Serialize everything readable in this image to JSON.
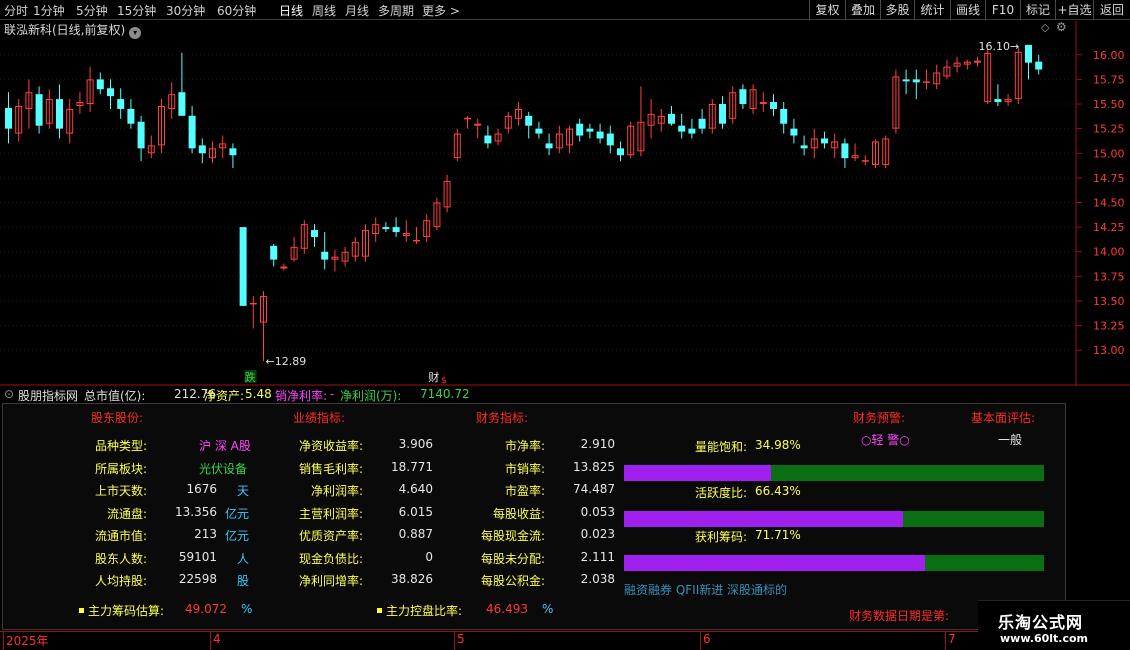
{
  "toolbar": {
    "periods": [
      "分时",
      "1分钟",
      "5分钟",
      "15分钟",
      "30分钟",
      "60分钟",
      "日线",
      "周线",
      "月线",
      "多周期",
      "更多 >"
    ],
    "active_period": "日线",
    "buttons": [
      "复权",
      "叠加",
      "多股",
      "统计",
      "画线",
      "F10",
      "标记",
      "+自选",
      "返回"
    ]
  },
  "chart": {
    "stock_title": "联泓新科(日线,前复权)",
    "settings_icon": "chevron-down-icon",
    "high_label": "16.10",
    "low_label": "12.89",
    "marker_down": "跌",
    "marker_fin": "财",
    "marker_fin_sub": "$"
  },
  "indicator": {
    "name": "股朋指标网",
    "total_mv_label": "总市值(亿):",
    "total_mv": "212.76",
    "net_assets_label": "净资产:",
    "net_assets": "5.48",
    "net_margin_label": "销净利率:",
    "net_margin": "-",
    "net_profit_label": "净利润(万):",
    "net_profit": "7140.72"
  },
  "panel": {
    "headers": {
      "holders": "股东股份:",
      "performance": "业绩指标:",
      "finance": "财务指标:",
      "warning": "财务预警:",
      "fundamental": "基本面评估:"
    },
    "col1": [
      {
        "label": "品种类型:",
        "value": "沪 深 A股",
        "unit": ""
      },
      {
        "label": "所属板块:",
        "value": "光伏设备",
        "unit": ""
      },
      {
        "label": "上市天数:",
        "value": "1676",
        "unit": "天"
      },
      {
        "label": "流通盘:",
        "value": "13.356",
        "unit": "亿元"
      },
      {
        "label": "流通市值:",
        "value": "213",
        "unit": "亿元"
      },
      {
        "label": "股东人数:",
        "value": "59101",
        "unit": "人"
      },
      {
        "label": "人均持股:",
        "value": "22598",
        "unit": "股"
      }
    ],
    "col2": [
      {
        "label": "净资收益率:",
        "value": "3.906"
      },
      {
        "label": "销售毛利率:",
        "value": "18.771"
      },
      {
        "label": "净利润率:",
        "value": "4.640"
      },
      {
        "label": "主营利润率:",
        "value": "6.015"
      },
      {
        "label": "优质资产率:",
        "value": "0.887"
      },
      {
        "label": "现金负债比:",
        "value": "0"
      },
      {
        "label": "净利同增率:",
        "value": "38.826"
      }
    ],
    "col3": [
      {
        "label": "市净率:",
        "value": "2.910"
      },
      {
        "label": "市销率:",
        "value": "13.825"
      },
      {
        "label": "市盈率:",
        "value": "74.487"
      },
      {
        "label": "每股收益:",
        "value": "0.053"
      },
      {
        "label": "每股现金流:",
        "value": "0.023"
      },
      {
        "label": "每股未分配:",
        "value": "2.111"
      },
      {
        "label": "每股公积金:",
        "value": "2.038"
      }
    ],
    "warning_value": "○轻 警○",
    "fundamental_value": "一般",
    "gauges": [
      {
        "label": "量能饱和:",
        "value": "34.98%",
        "fraction": 0.3498
      },
      {
        "label": "活跃度比:",
        "value": "66.43%",
        "fraction": 0.6643
      },
      {
        "label": "获利筹码:",
        "value": "71.71%",
        "fraction": 0.7171
      }
    ],
    "tags": "融资融券 QFII新进 深股通标的",
    "main_chip_label": "主力筹码估算:",
    "main_chip_value": "49.072",
    "main_chip_unit": "%",
    "main_control_label": "主力控盘比率:",
    "main_control_value": "46.493",
    "main_control_unit": "%",
    "fin_date_label": "财务数据日期是第:"
  },
  "date_axis": {
    "labels": [
      "2025年",
      "4",
      "5",
      "6",
      "7"
    ]
  },
  "watermark": {
    "line1": "乐淘公式网",
    "line2": "www.60lt.com"
  },
  "colors": {
    "up": "#ff4040",
    "down": "#54ffff",
    "axis": "#a01010"
  },
  "chart_data": {
    "type": "candlestick",
    "y_ticks": [
      "16.00",
      "15.75",
      "15.50",
      "15.25",
      "15.00",
      "14.75",
      "14.50",
      "14.25",
      "14.00",
      "13.75",
      "13.50",
      "13.25",
      "13.00"
    ],
    "ylim": [
      12.85,
      16.15
    ],
    "candles": [
      [
        15.46,
        15.62,
        15.1,
        15.25
      ],
      [
        15.2,
        15.55,
        15.12,
        15.48
      ],
      [
        15.45,
        15.75,
        15.25,
        15.62
      ],
      [
        15.6,
        15.68,
        15.2,
        15.28
      ],
      [
        15.3,
        15.65,
        15.25,
        15.55
      ],
      [
        15.55,
        15.7,
        15.15,
        15.25
      ],
      [
        15.2,
        15.55,
        15.1,
        15.45
      ],
      [
        15.48,
        15.62,
        15.4,
        15.52
      ],
      [
        15.5,
        15.88,
        15.42,
        15.75
      ],
      [
        15.75,
        15.82,
        15.6,
        15.65
      ],
      [
        15.66,
        15.75,
        15.45,
        15.58
      ],
      [
        15.55,
        15.66,
        15.35,
        15.45
      ],
      [
        15.45,
        15.55,
        15.25,
        15.3
      ],
      [
        15.32,
        15.38,
        14.92,
        15.05
      ],
      [
        15.0,
        15.18,
        14.95,
        15.08
      ],
      [
        15.08,
        15.55,
        15.0,
        15.48
      ],
      [
        15.45,
        15.72,
        15.35,
        15.6
      ],
      [
        15.62,
        16.02,
        15.5,
        15.38
      ],
      [
        15.38,
        15.48,
        15.0,
        15.05
      ],
      [
        15.08,
        15.15,
        14.9,
        15.0
      ],
      [
        14.95,
        15.12,
        14.9,
        15.05
      ],
      [
        15.05,
        15.18,
        14.95,
        15.1
      ],
      [
        15.05,
        15.1,
        14.85,
        14.98
      ],
      [
        14.25,
        14.25,
        13.45,
        13.45
      ],
      [
        13.48,
        13.55,
        13.22,
        13.48
      ],
      [
        13.28,
        13.6,
        12.89,
        13.55
      ],
      [
        14.06,
        14.08,
        13.85,
        13.92
      ],
      [
        13.83,
        13.88,
        13.81,
        13.85
      ],
      [
        13.92,
        14.15,
        13.9,
        14.05
      ],
      [
        14.03,
        14.32,
        13.98,
        14.28
      ],
      [
        14.22,
        14.28,
        14.05,
        14.15
      ],
      [
        14.0,
        14.2,
        13.82,
        13.92
      ],
      [
        13.92,
        14.02,
        13.8,
        13.95
      ],
      [
        13.9,
        14.05,
        13.85,
        14.0
      ],
      [
        13.95,
        14.15,
        13.9,
        14.1
      ],
      [
        13.95,
        14.28,
        13.9,
        14.22
      ],
      [
        14.18,
        14.35,
        14.1,
        14.28
      ],
      [
        14.25,
        14.3,
        14.2,
        14.23
      ],
      [
        14.25,
        14.35,
        14.15,
        14.2
      ],
      [
        14.16,
        14.32,
        14.1,
        14.19
      ],
      [
        14.12,
        14.25,
        14.08,
        14.12
      ],
      [
        14.15,
        14.38,
        14.1,
        14.32
      ],
      [
        14.25,
        14.55,
        14.22,
        14.5
      ],
      [
        14.45,
        14.78,
        14.4,
        14.72
      ],
      [
        14.95,
        15.25,
        14.92,
        15.2
      ],
      [
        15.35,
        15.38,
        15.25,
        15.36
      ],
      [
        15.28,
        15.35,
        15.15,
        15.3
      ],
      [
        15.18,
        15.28,
        15.05,
        15.1
      ],
      [
        15.12,
        15.25,
        15.08,
        15.2
      ],
      [
        15.25,
        15.42,
        15.2,
        15.38
      ],
      [
        15.35,
        15.52,
        15.28,
        15.45
      ],
      [
        15.38,
        15.42,
        15.15,
        15.28
      ],
      [
        15.25,
        15.32,
        15.15,
        15.2
      ],
      [
        15.1,
        15.2,
        14.98,
        15.05
      ],
      [
        15.05,
        15.28,
        15.0,
        15.2
      ],
      [
        15.08,
        15.28,
        15.0,
        15.25
      ],
      [
        15.3,
        15.35,
        15.12,
        15.18
      ],
      [
        15.25,
        15.3,
        15.15,
        15.22
      ],
      [
        15.22,
        15.3,
        15.1,
        15.15
      ],
      [
        15.2,
        15.28,
        15.0,
        15.08
      ],
      [
        15.05,
        15.12,
        14.92,
        14.98
      ],
      [
        14.98,
        15.32,
        14.95,
        15.28
      ],
      [
        15.02,
        15.68,
        14.97,
        15.32
      ],
      [
        15.28,
        15.55,
        15.15,
        15.4
      ],
      [
        15.3,
        15.45,
        15.22,
        15.38
      ],
      [
        15.4,
        15.48,
        15.28,
        15.3
      ],
      [
        15.28,
        15.4,
        15.15,
        15.22
      ],
      [
        15.25,
        15.35,
        15.15,
        15.2
      ],
      [
        15.35,
        15.45,
        15.2,
        15.25
      ],
      [
        15.25,
        15.55,
        15.2,
        15.5
      ],
      [
        15.5,
        15.58,
        15.25,
        15.3
      ],
      [
        15.35,
        15.68,
        15.3,
        15.62
      ],
      [
        15.65,
        15.7,
        15.45,
        15.5
      ],
      [
        15.45,
        15.7,
        15.4,
        15.65
      ],
      [
        15.5,
        15.62,
        15.42,
        15.52
      ],
      [
        15.52,
        15.6,
        15.38,
        15.45
      ],
      [
        15.45,
        15.52,
        15.2,
        15.3
      ],
      [
        15.25,
        15.35,
        15.1,
        15.18
      ],
      [
        15.08,
        15.18,
        14.98,
        15.05
      ],
      [
        15.05,
        15.25,
        14.95,
        15.15
      ],
      [
        15.15,
        15.22,
        15.05,
        15.1
      ],
      [
        15.05,
        15.2,
        14.95,
        15.12
      ],
      [
        15.1,
        15.15,
        14.85,
        14.95
      ],
      [
        14.95,
        15.1,
        14.92,
        14.98
      ],
      [
        14.92,
        14.98,
        14.88,
        14.93
      ],
      [
        14.88,
        15.14,
        14.85,
        15.12
      ],
      [
        14.88,
        15.18,
        14.85,
        15.15
      ],
      [
        15.25,
        15.85,
        15.2,
        15.78
      ],
      [
        15.75,
        15.85,
        15.6,
        15.73
      ],
      [
        15.75,
        15.85,
        15.55,
        15.72
      ],
      [
        15.72,
        15.85,
        15.65,
        15.73
      ],
      [
        15.7,
        15.9,
        15.65,
        15.82
      ],
      [
        15.78,
        15.95,
        15.75,
        15.88
      ],
      [
        15.88,
        15.98,
        15.82,
        15.92
      ],
      [
        15.9,
        15.95,
        15.85,
        15.93
      ],
      [
        15.92,
        15.98,
        15.88,
        15.94
      ],
      [
        15.52,
        16.06,
        15.5,
        16.02
      ],
      [
        15.55,
        15.7,
        15.48,
        15.52
      ],
      [
        15.52,
        15.6,
        15.48,
        15.55
      ],
      [
        15.55,
        16.08,
        15.5,
        16.03
      ],
      [
        16.1,
        16.1,
        15.75,
        15.92
      ],
      [
        15.93,
        16.0,
        15.8,
        15.85
      ]
    ]
  }
}
